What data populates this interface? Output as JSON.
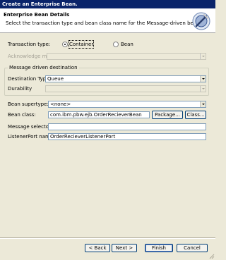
{
  "window": {
    "title": "Create an Enterprise Bean."
  },
  "banner": {
    "title": "Enterprise Bean Details",
    "description": "Select the transaction type and bean class name for the Message-driven bean.",
    "icon": "bean-wizard-icon"
  },
  "transaction": {
    "label": "Transaction type:",
    "options": [
      {
        "label": "Container",
        "selected": true
      },
      {
        "label": "Bean",
        "selected": false
      }
    ]
  },
  "acknowledge": {
    "label": "Acknowledge mode",
    "value": "",
    "enabled": false
  },
  "destination_group": {
    "legend": "Message driven destination",
    "destination_type": {
      "label": "Destination Type",
      "value": "Queue"
    },
    "durability": {
      "label": "Durability",
      "value": "",
      "enabled": false
    }
  },
  "bean_supertype": {
    "label": "Bean supertype:",
    "value": "<none>"
  },
  "bean_class": {
    "label": "Bean class:",
    "value": "com.ibm.pbw.ejb.OrderRecieverBean"
  },
  "message_selector": {
    "label": "Message selector",
    "value": ""
  },
  "listener_port": {
    "label": "ListenerPort name:",
    "value": "OrderRecieverListenerPort"
  },
  "side_buttons": {
    "package": "Package...",
    "class": "Class..."
  },
  "footer": {
    "back": "< Back",
    "next": "Next >",
    "finish": "Finish",
    "cancel": "Cancel"
  }
}
